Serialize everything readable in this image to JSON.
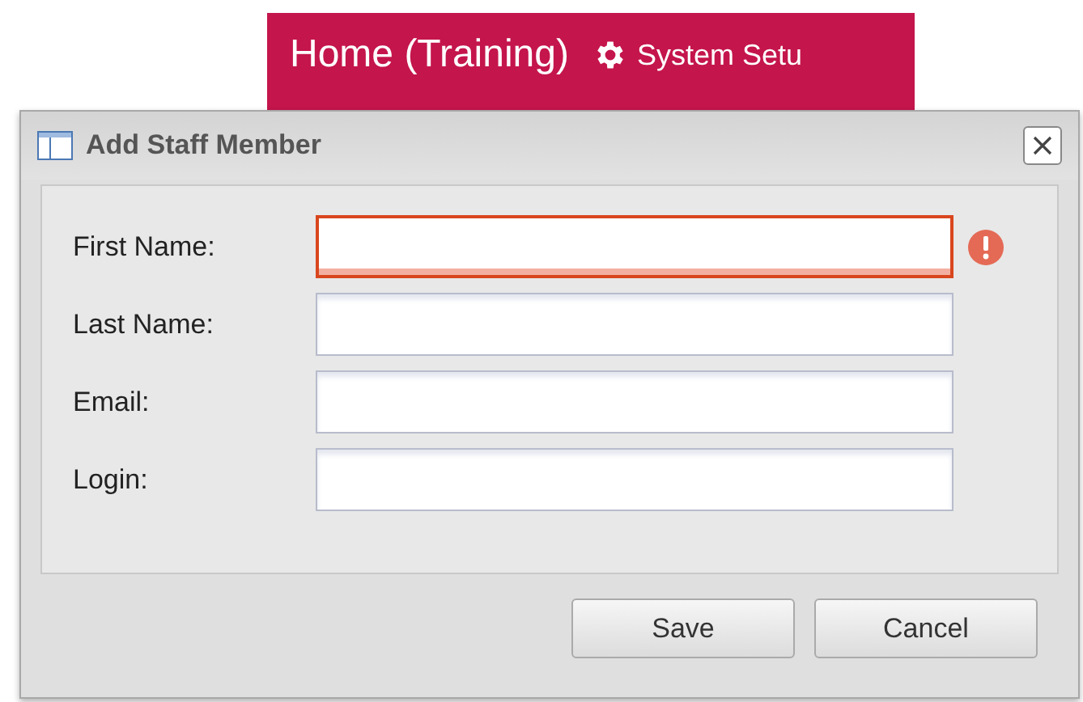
{
  "banner": {
    "title": "Home (Training)",
    "link": "System Setu"
  },
  "dialog": {
    "title": "Add Staff Member",
    "fields": [
      {
        "label": "First Name:",
        "invalid": true
      },
      {
        "label": "Last Name:",
        "invalid": false
      },
      {
        "label": "Email:",
        "invalid": false
      },
      {
        "label": "Login:",
        "invalid": false
      }
    ],
    "buttons": [
      "Save",
      "Cancel"
    ]
  }
}
